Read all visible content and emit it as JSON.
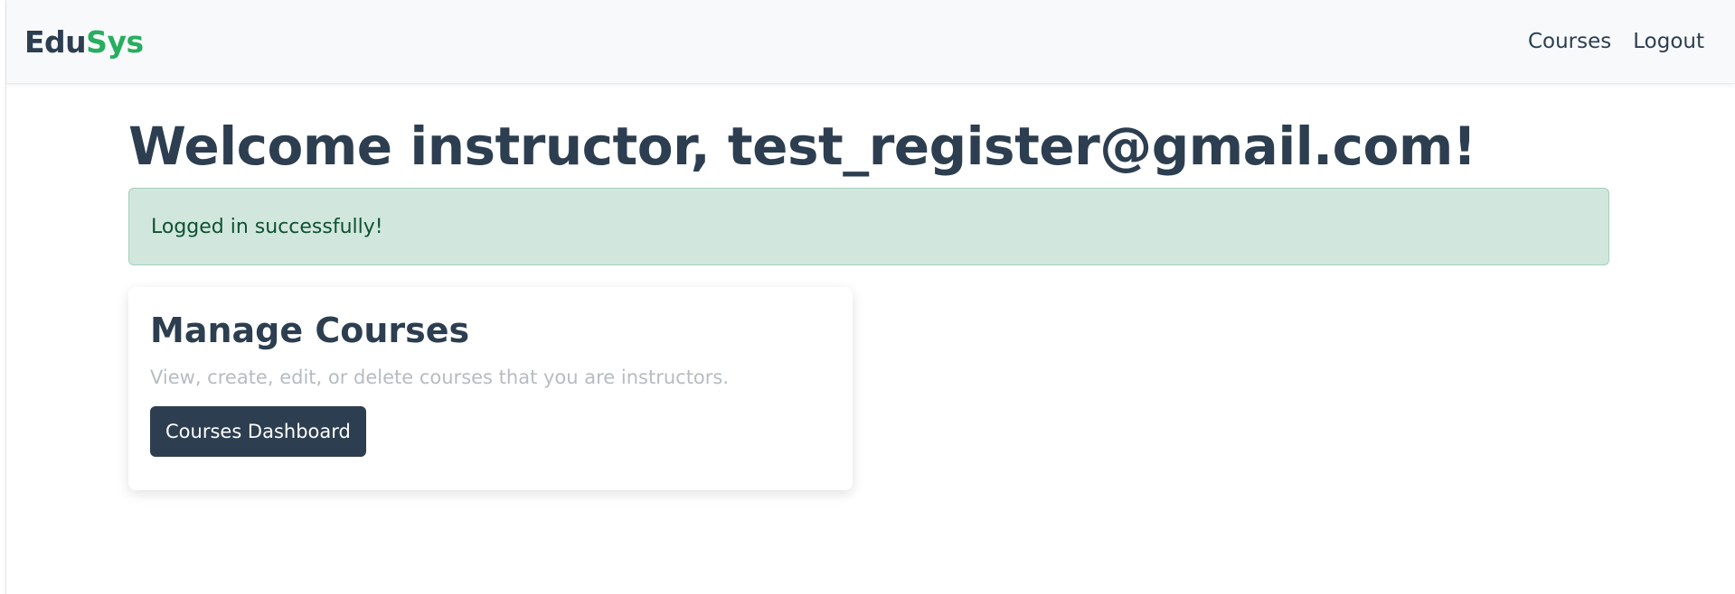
{
  "navbar": {
    "brand_part1": "Edu",
    "brand_part2": "Sys",
    "links": [
      {
        "label": "Courses"
      },
      {
        "label": "Logout"
      }
    ]
  },
  "main": {
    "welcome_heading": "Welcome instructor, test_register@gmail.com!",
    "alert_message": "Logged in successfully!",
    "card": {
      "title": "Manage Courses",
      "description": "View, create, edit, or delete courses that you are instructors.",
      "button_label": "Courses Dashboard"
    }
  },
  "colors": {
    "primary": "#2c3e50",
    "brand_accent": "#27ae60",
    "alert_background": "#d1e7dd",
    "alert_border": "#a3cfbb",
    "muted_text": "#b7bcc1"
  }
}
